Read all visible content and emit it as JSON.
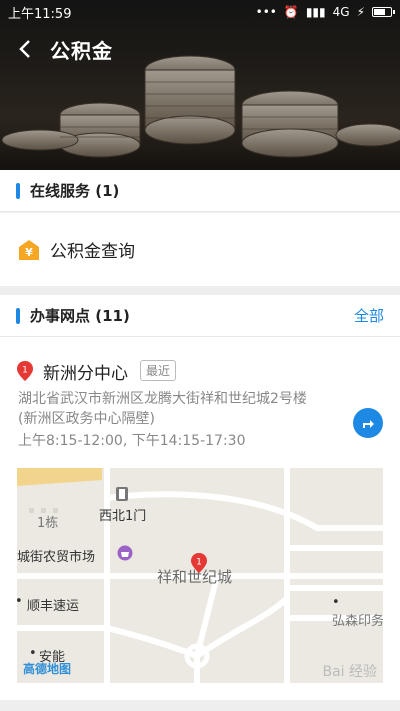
{
  "status_bar": {
    "time": "上午11:59",
    "network": "4G"
  },
  "header": {
    "title": "公积金"
  },
  "online_services": {
    "title": "在线服务 (1)",
    "items": [
      {
        "label": "公积金查询",
        "icon": "yuan-coin-icon"
      }
    ]
  },
  "offices": {
    "title": "办事网点 (11)",
    "all_label": "全部",
    "items": [
      {
        "name": "新洲分中心",
        "badge": "最近",
        "address": "湖北省武汉市新洲区龙腾大街祥和世纪城2号楼 (新洲区政务中心隔壁)",
        "hours": "上午8:15-12:00, 下午14:15-17:30",
        "pin_number": "1"
      }
    ]
  },
  "map": {
    "labels": {
      "building": "1栋",
      "gate": "西北1门",
      "market": "城街农贸市场",
      "community": "祥和世纪城",
      "shun": "顺丰速运",
      "hong": "弘森印务",
      "anneng": "安能",
      "logo": "高德地图",
      "watermark": "Bai 经验"
    },
    "pin_number": "1"
  },
  "colors": {
    "accent": "#1e88e5",
    "pin": "#e53935"
  }
}
